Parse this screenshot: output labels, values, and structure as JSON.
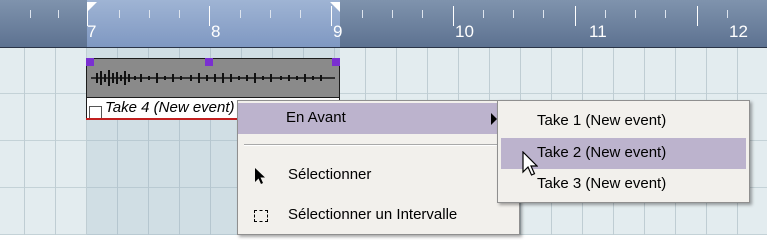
{
  "ruler": {
    "bars": [
      {
        "label": "7"
      },
      {
        "label": "8"
      },
      {
        "label": "9"
      },
      {
        "label": "10"
      },
      {
        "label": "11"
      },
      {
        "label": "12"
      }
    ]
  },
  "event": {
    "label": "Take 4 (New event)"
  },
  "context_menu": {
    "items": [
      {
        "label": "En Avant",
        "has_submenu": true,
        "highlighted": true,
        "icon": ""
      },
      {
        "label": "Sélectionner",
        "has_submenu": false,
        "highlighted": false,
        "icon": "arrow-pointer-icon"
      },
      {
        "label": "Sélectionner un Intervalle",
        "has_submenu": false,
        "highlighted": false,
        "icon": "range-select-icon"
      }
    ]
  },
  "submenu": {
    "items": [
      {
        "label": "Take 1 (New event)",
        "highlighted": false
      },
      {
        "label": "Take 2 (New event)",
        "highlighted": true
      },
      {
        "label": "Take 3 (New event)",
        "highlighted": false
      }
    ]
  },
  "colors": {
    "ruler": "#6b7f9c",
    "loop_range": "#8da5cc",
    "menu_highlight": "#bcb3cd",
    "event_bg": "#8a8a8a",
    "event_handle": "#7a2fd1",
    "selection_line": "#c21f1f"
  }
}
